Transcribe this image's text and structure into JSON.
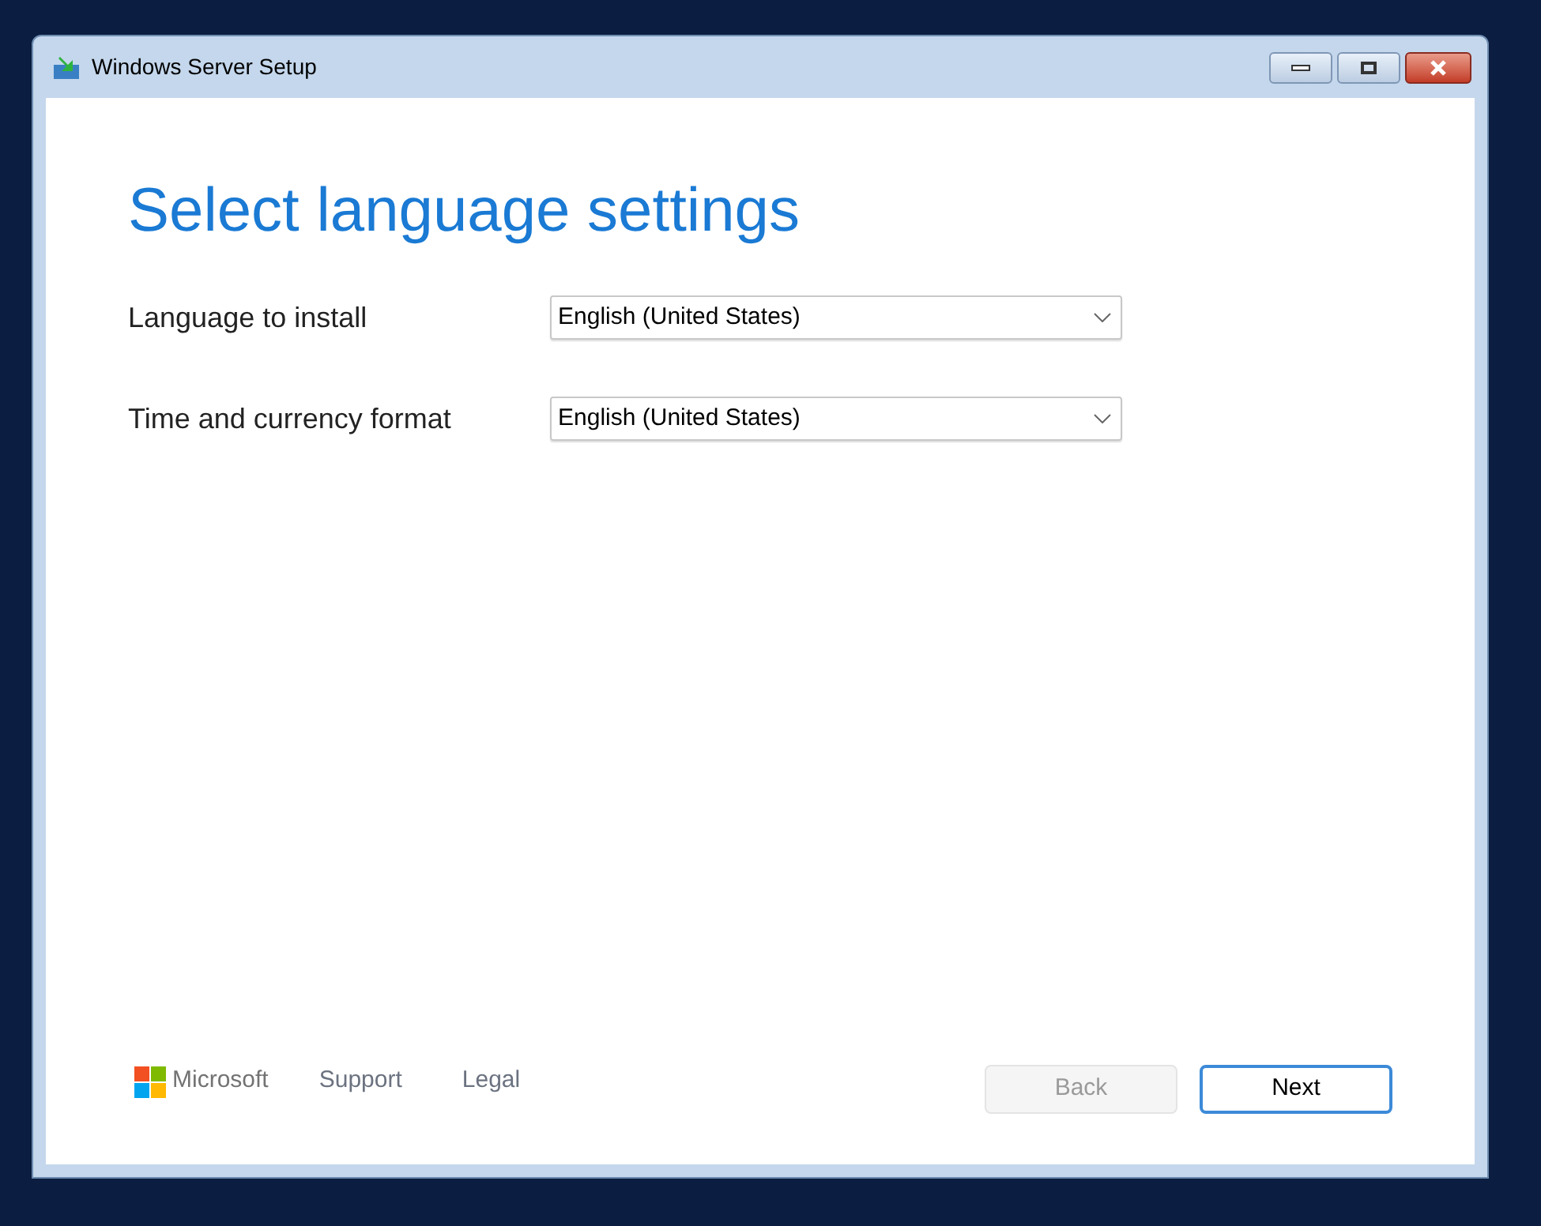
{
  "window": {
    "title": "Windows Server Setup"
  },
  "heading": "Select language settings",
  "fields": [
    {
      "label": "Language to install",
      "value": "English (United States)"
    },
    {
      "label": "Time and currency format",
      "value": "English (United States)"
    }
  ],
  "footer": {
    "brand": "Microsoft",
    "links": [
      "Support",
      "Legal"
    ]
  },
  "buttons": [
    {
      "label": "Back",
      "disabled": true
    },
    {
      "label": "Next",
      "disabled": false
    }
  ]
}
